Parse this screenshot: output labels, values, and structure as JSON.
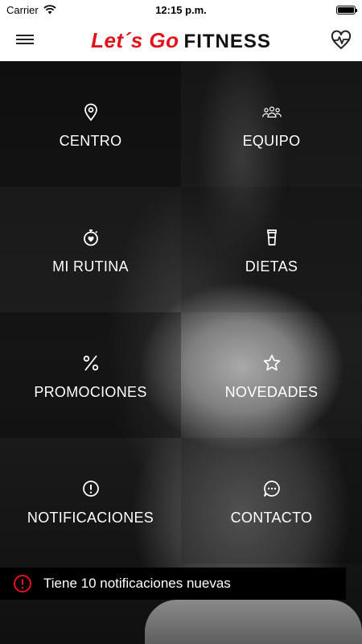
{
  "status_bar": {
    "carrier": "Carrier",
    "time": "12:15 p.m.",
    "battery_level": 1.0
  },
  "header": {
    "logo_script": "Let´s Go",
    "logo_word": "FITNESS",
    "menu_icon": "hamburger-menu-icon",
    "right_icon": "heart-pulse-icon"
  },
  "menu": [
    {
      "label": "CENTRO",
      "icon": "location-pin-icon"
    },
    {
      "label": "EQUIPO",
      "icon": "team-icon"
    },
    {
      "label": "MI RUTINA",
      "icon": "stopwatch-heart-icon"
    },
    {
      "label": "DIETAS",
      "icon": "shaker-cup-icon"
    },
    {
      "label": "PROMOCIONES",
      "icon": "percent-icon"
    },
    {
      "label": "NOVEDADES",
      "icon": "star-icon"
    },
    {
      "label": "NOTIFICACIONES",
      "icon": "alert-circle-icon"
    },
    {
      "label": "CONTACTO",
      "icon": "chat-bubble-icon"
    }
  ],
  "notification_banner": {
    "text": "Tiene 10 notificaciones nuevas",
    "icon": "alert-circle-icon",
    "icon_color": "#e1141c"
  },
  "colors": {
    "brand_red": "#e1141c",
    "header_bg": "#ffffff",
    "menu_text": "#ffffff"
  }
}
